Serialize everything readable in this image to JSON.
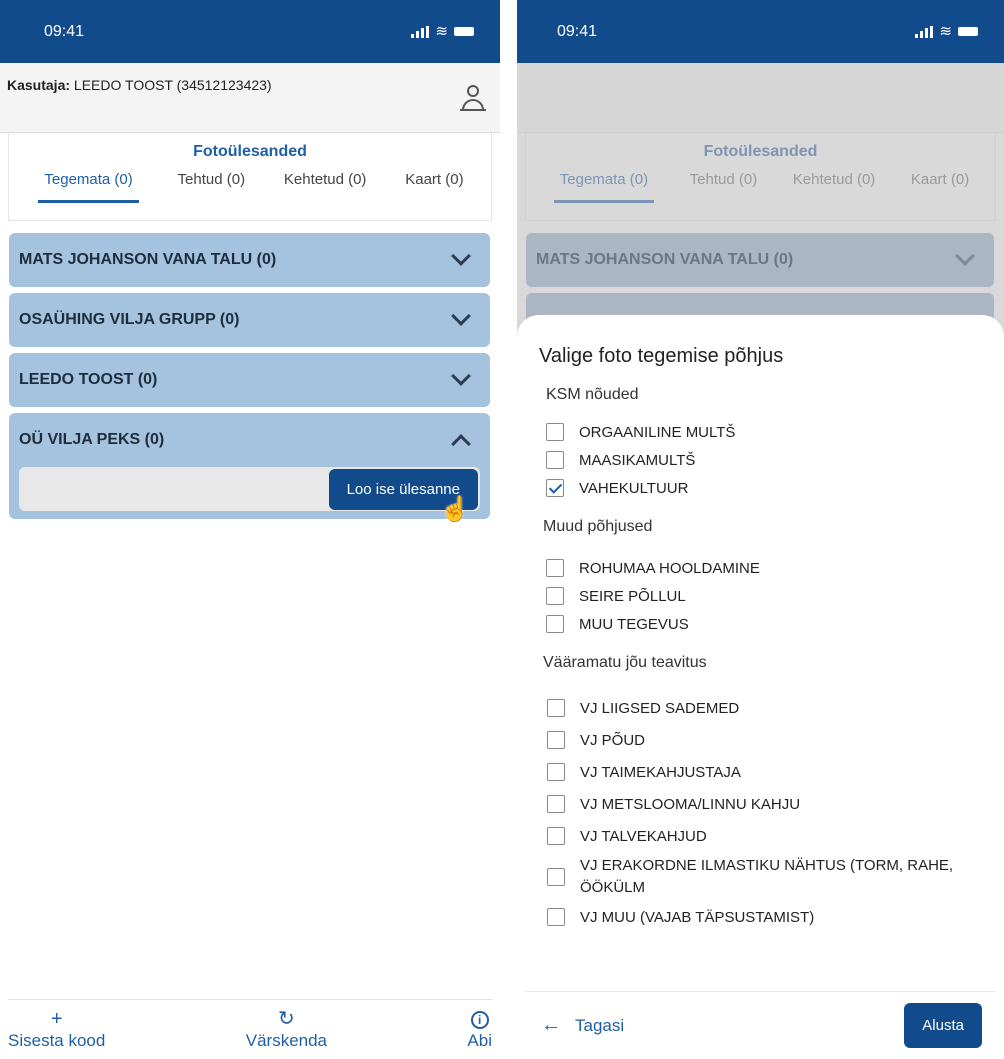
{
  "left": {
    "status": {
      "time": "09:41"
    },
    "user": {
      "label": "Kasutaja:",
      "value": "LEEDO TOOST (34512123423)"
    },
    "section_title": "Fotoülesanded",
    "tabs": [
      {
        "label": "Tegemata (0)"
      },
      {
        "label": "Tehtud (0)"
      },
      {
        "label": "Kehtetud (0)"
      },
      {
        "label": "Kaart (0)"
      }
    ],
    "groups": [
      {
        "label": "MATS JOHANSON VANA TALU (0)"
      },
      {
        "label": "OSAÜHING VILJA GRUPP (0)"
      },
      {
        "label": "LEEDO TOOST (0)"
      },
      {
        "label": "OÜ VILJA PEKS (0)",
        "button": "Loo ise ülesanne"
      }
    ],
    "nav": [
      {
        "label": "Sisesta kood",
        "icon": "+"
      },
      {
        "label": "Värskenda",
        "icon": "↻"
      },
      {
        "label": "Abi",
        "icon": "i"
      }
    ]
  },
  "right": {
    "status": {
      "time": "09:41"
    },
    "section_title": "Fotoülesanded",
    "tabs": [
      {
        "label": "Tegemata (0)"
      },
      {
        "label": "Tehtud (0)"
      },
      {
        "label": "Kehtetud (0)"
      },
      {
        "label": "Kaart (0)"
      }
    ],
    "groups": [
      {
        "label": "MATS JOHANSON VANA TALU (0)"
      }
    ],
    "sheet": {
      "title": "Valige foto tegemise põhjus",
      "sections": [
        {
          "title": "KSM nõuded",
          "options": [
            {
              "label": "ORGAANILINE MULTŠ",
              "checked": false
            },
            {
              "label": "MAASIKAMULTŠ",
              "checked": false
            },
            {
              "label": "VAHEKULTUUR",
              "checked": true
            }
          ]
        },
        {
          "title": "Muud põhjused",
          "options": [
            {
              "label": "ROHUMAA HOOLDAMINE",
              "checked": false
            },
            {
              "label": "SEIRE PÕLLUL",
              "checked": false
            },
            {
              "label": "MUU TEGEVUS",
              "checked": false
            }
          ]
        },
        {
          "title": "Vääramatu jõu teavitus",
          "options": [
            {
              "label": "VJ LIIGSED SADEMED",
              "checked": false
            },
            {
              "label": "VJ PÕUD",
              "checked": false
            },
            {
              "label": "VJ TAIMEKAHJUSTAJA",
              "checked": false
            },
            {
              "label": "VJ METSLOOMA/LINNU KAHJU",
              "checked": false
            },
            {
              "label": "VJ TALVEKAHJUD",
              "checked": false
            },
            {
              "label": "VJ ERAKORDNE ILMASTIKU NÄHTUS (TORM, RAHE, ÖÖKÜLM",
              "checked": false
            },
            {
              "label": "VJ MUU (VAJAB TÄPSUSTAMIST)",
              "checked": false
            }
          ]
        }
      ],
      "back_label": "Tagasi",
      "start_label": "Alusta"
    }
  }
}
